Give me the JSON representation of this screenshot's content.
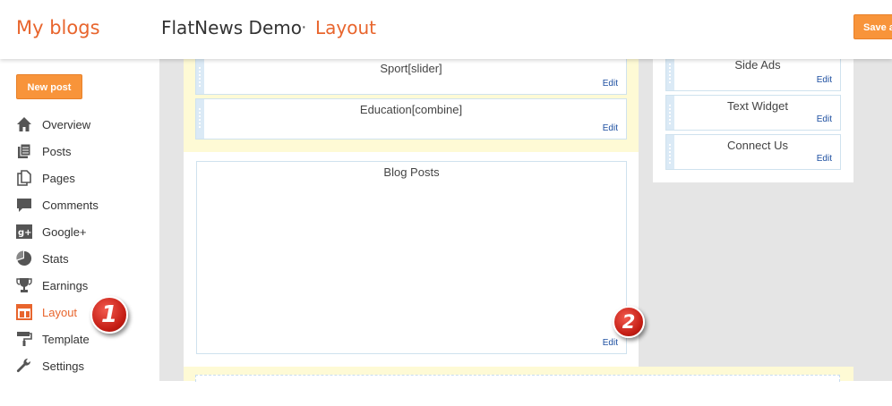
{
  "header": {
    "brand": "My blogs",
    "blog_title": "FlatNews Demo",
    "separator": "·",
    "page_title": "Layout",
    "save_label": "Save a"
  },
  "sidebar": {
    "new_post_label": "New post",
    "items": [
      {
        "label": "Overview",
        "icon": "home-icon"
      },
      {
        "label": "Posts",
        "icon": "posts-icon"
      },
      {
        "label": "Pages",
        "icon": "pages-icon"
      },
      {
        "label": "Comments",
        "icon": "comments-icon"
      },
      {
        "label": "Google+",
        "icon": "google-plus-icon"
      },
      {
        "label": "Stats",
        "icon": "stats-icon"
      },
      {
        "label": "Earnings",
        "icon": "trophy-icon"
      },
      {
        "label": "Layout",
        "icon": "layout-icon",
        "active": true
      },
      {
        "label": "Template",
        "icon": "paint-roller-icon"
      },
      {
        "label": "Settings",
        "icon": "wrench-icon"
      }
    ]
  },
  "layout": {
    "gadgets_main": [
      {
        "title": "Sport[slider]",
        "edit": "Edit"
      },
      {
        "title": "Education[combine]",
        "edit": "Edit"
      }
    ],
    "blog_posts": {
      "title": "Blog Posts",
      "edit": "Edit"
    },
    "gadgets_side": [
      {
        "title": "Side Ads",
        "edit": "Edit"
      },
      {
        "title": "Text Widget",
        "edit": "Edit"
      },
      {
        "title": "Connect Us",
        "edit": "Edit"
      }
    ]
  },
  "annotations": {
    "step1": "1",
    "step2": "2"
  },
  "colors": {
    "accent": "#e8652d",
    "button": "#f8943a",
    "link": "#1c4ea0",
    "highlight": "#fefad5"
  }
}
